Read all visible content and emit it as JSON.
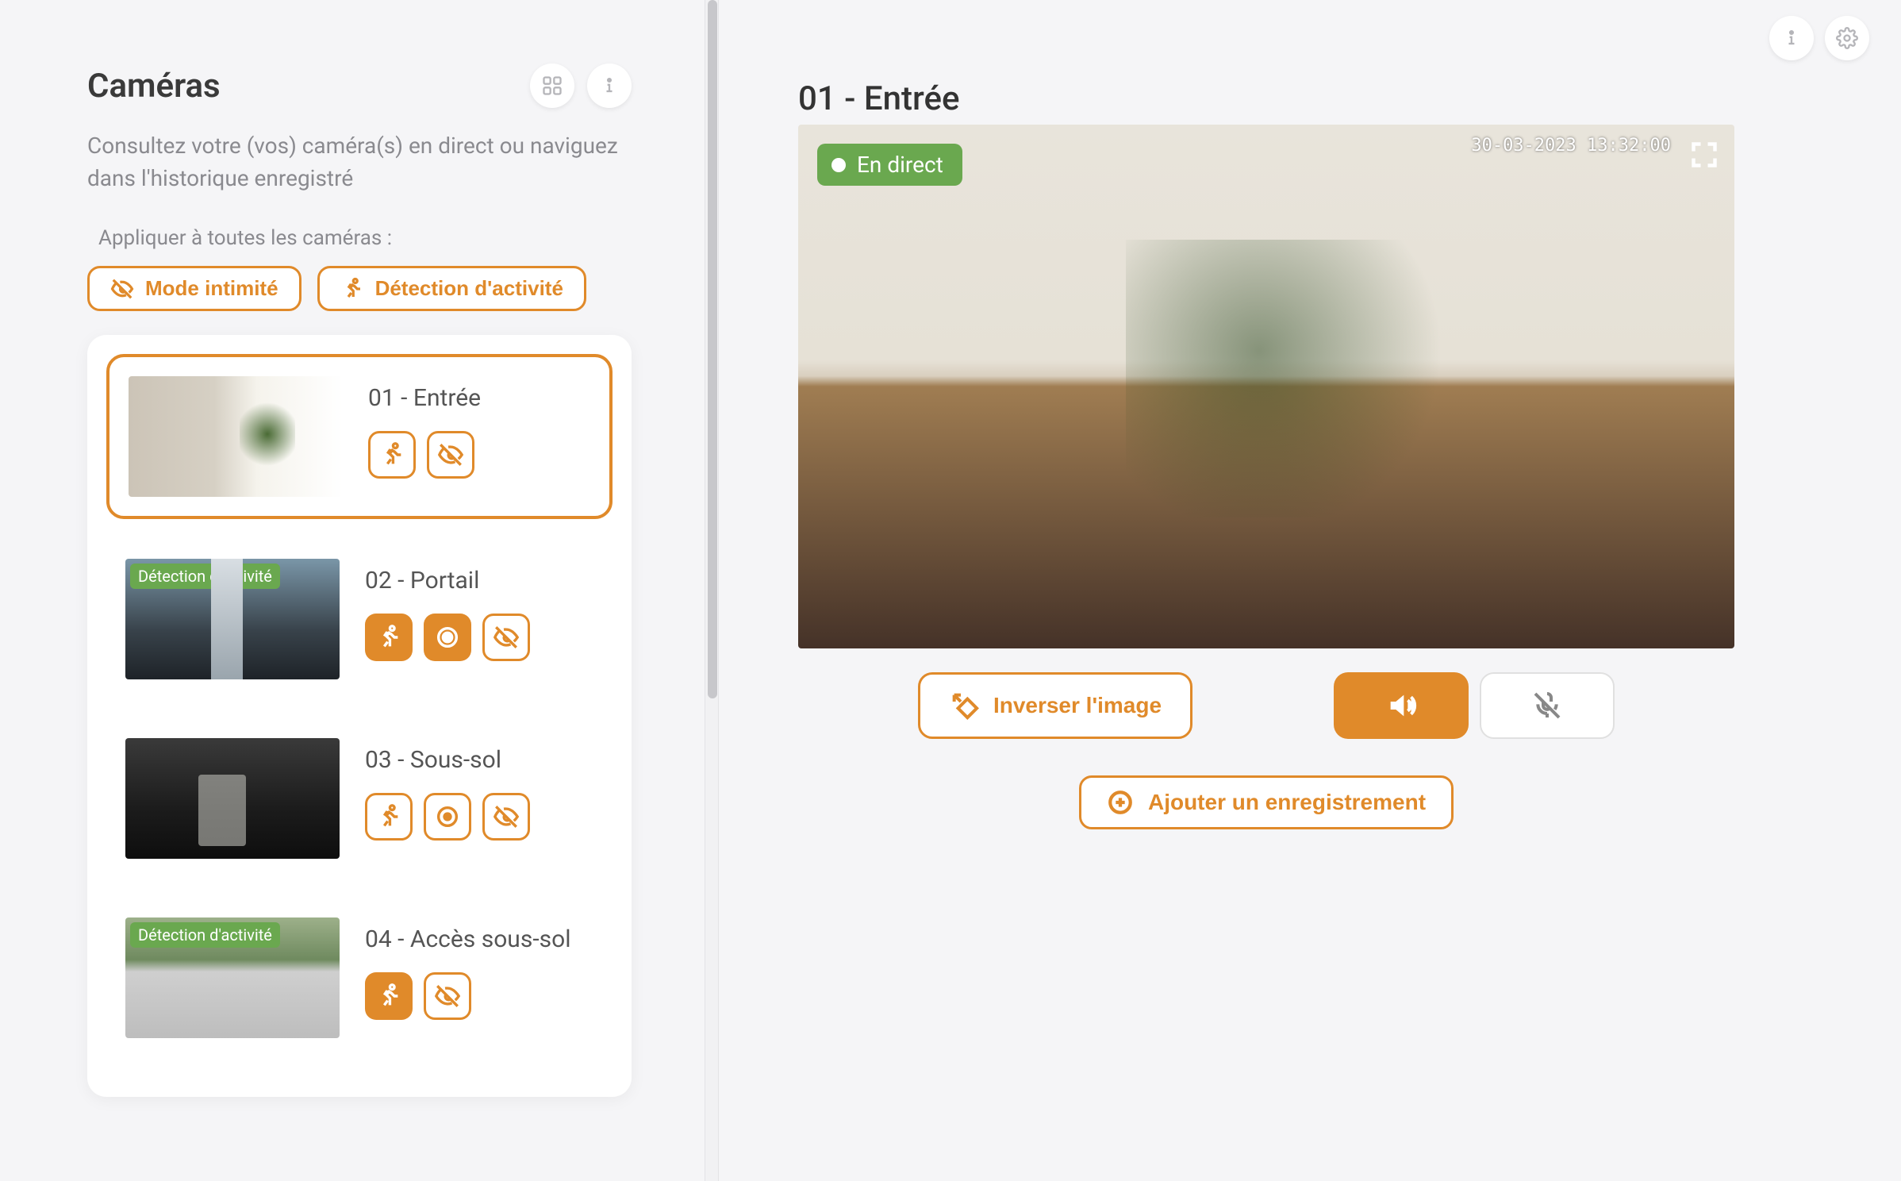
{
  "sidebar": {
    "title": "Caméras",
    "subtitle": "Consultez votre (vos) caméra(s) en direct ou naviguez dans l'historique enregistré",
    "bulk_label": "Appliquer à toutes les caméras :",
    "privacy_btn": "Mode intimité",
    "activity_btn": "Détection d'activité",
    "detection_badge": "Détection d'activité"
  },
  "cameras": [
    {
      "name": "01 - Entrée",
      "selected": true,
      "detection_badge": false
    },
    {
      "name": "02 - Portail",
      "selected": false,
      "detection_badge": true
    },
    {
      "name": "03 - Sous-sol",
      "selected": false,
      "detection_badge": false
    },
    {
      "name": "04 - Accès sous-sol",
      "selected": false,
      "detection_badge": true
    }
  ],
  "main": {
    "title": "01 - Entrée",
    "live_label": "En direct",
    "timestamp": "30-03-2023 13:32:00",
    "flip_label": "Inverser l'image",
    "add_recording": "Ajouter un enregistrement"
  },
  "colors": {
    "accent": "#e08a2a",
    "live_green": "#6aa84f"
  }
}
